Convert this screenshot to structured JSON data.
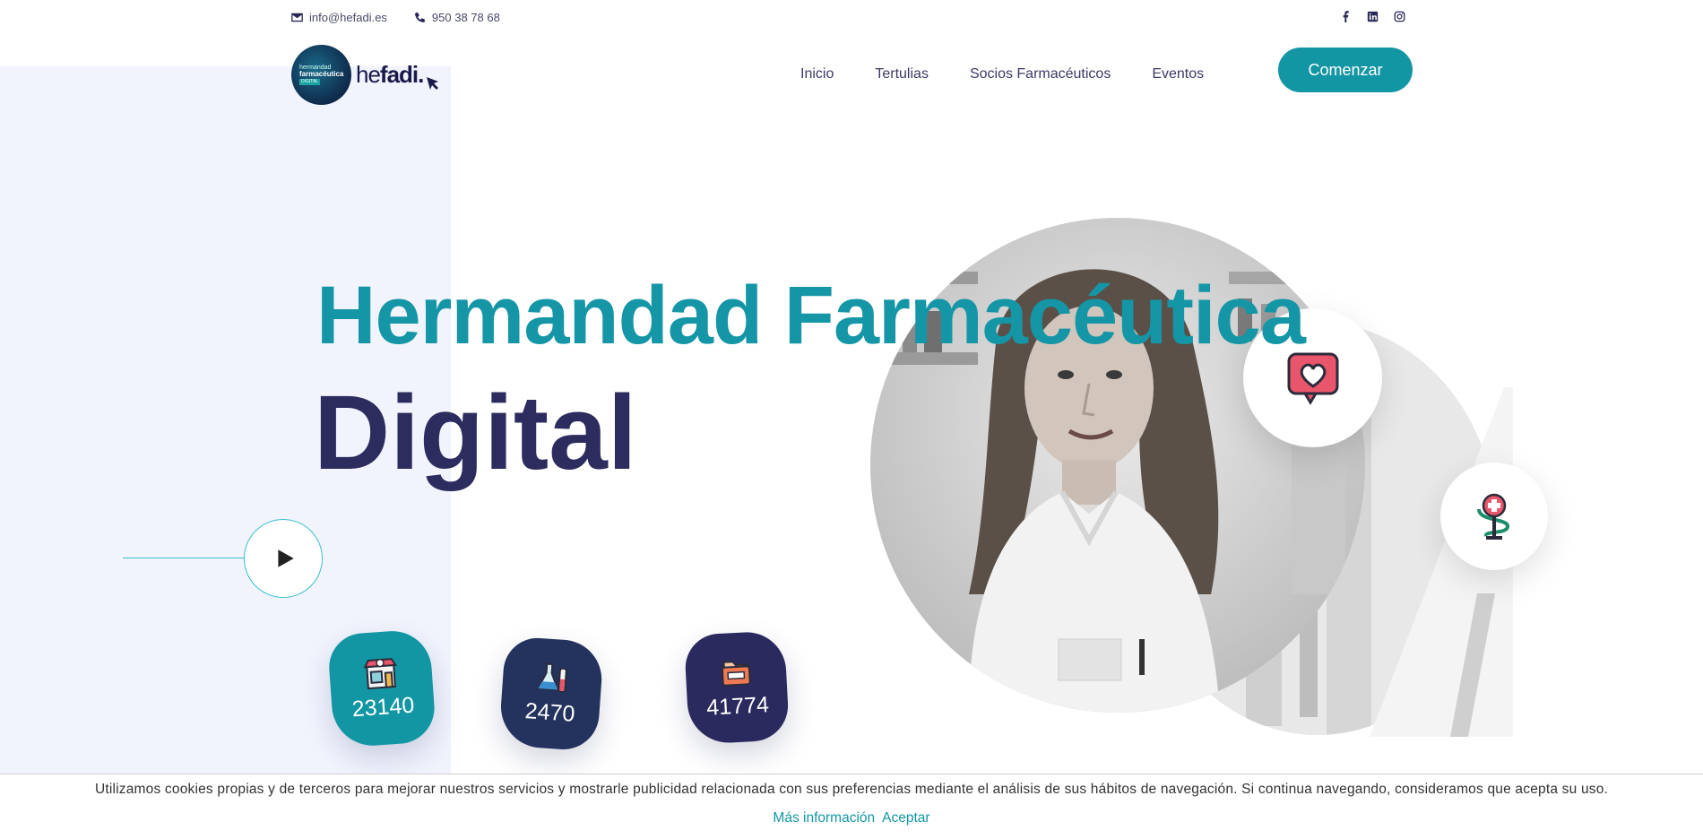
{
  "topbar": {
    "email": "info@hefadi.es",
    "phone": "950 38 78 68",
    "social": [
      "facebook-icon",
      "linkedin-icon",
      "instagram-icon"
    ]
  },
  "logo": {
    "line1": "hermandad",
    "line2": "farmacéutica",
    "line3": "DIGITAL",
    "word_light": "he",
    "word_bold": "fadi."
  },
  "nav": {
    "items": [
      "Inicio",
      "Tertulias",
      "Socios Farmacéuticos",
      "Eventos"
    ],
    "cta": "Comenzar"
  },
  "hero": {
    "title_line1": "Hermandad Farmacéutica",
    "title_line2": "Digital"
  },
  "stats": [
    {
      "icon": "pharmacy-store-icon",
      "value": "23140"
    },
    {
      "icon": "lab-flasks-icon",
      "value": "2470"
    },
    {
      "icon": "medicine-box-icon",
      "value": "41774"
    }
  ],
  "badges": [
    "heart-message-icon",
    "pharmacy-caduceus-icon"
  ],
  "cookie": {
    "message": "Utilizamos cookies propias y de terceros para mejorar nuestros servicios y mostrarle publicidad relacionada con sus preferencias mediante el análisis de sus hábitos de navegación. Si continua navegando, consideramos que acepta su uso.",
    "more_info": "Más información",
    "accept": "Aceptar"
  },
  "colors": {
    "accent": "#1396a4",
    "dark": "#2c2c5e",
    "panel": "#f1f3fd"
  }
}
